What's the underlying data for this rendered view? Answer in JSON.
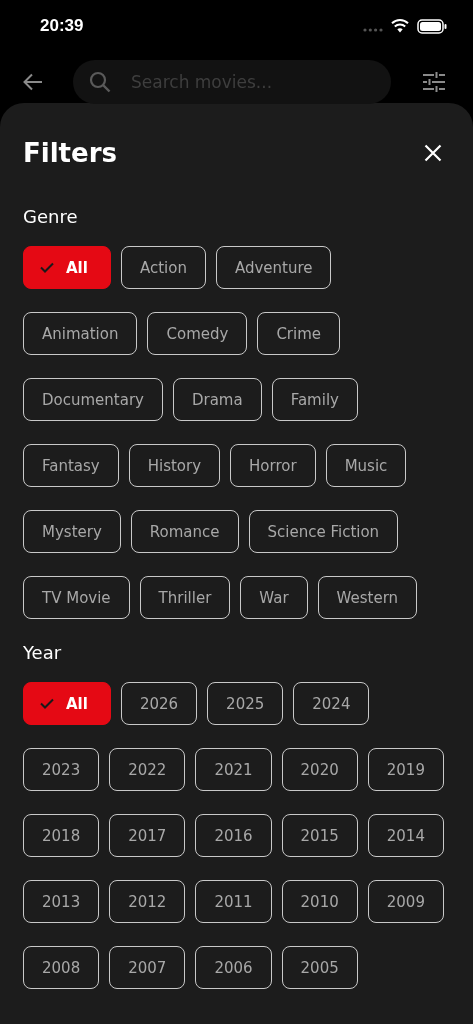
{
  "status_bar": {
    "time": "20:39"
  },
  "search": {
    "placeholder": "Search movies..."
  },
  "sheet": {
    "title": "Filters"
  },
  "sections": [
    {
      "label": "Genre",
      "rows": [
        [
          {
            "label": "All",
            "selected": true
          },
          {
            "label": "Action",
            "selected": false
          },
          {
            "label": "Adventure",
            "selected": false
          }
        ],
        [
          {
            "label": "Animation",
            "selected": false
          },
          {
            "label": "Comedy",
            "selected": false
          },
          {
            "label": "Crime",
            "selected": false
          }
        ],
        [
          {
            "label": "Documentary",
            "selected": false
          },
          {
            "label": "Drama",
            "selected": false
          },
          {
            "label": "Family",
            "selected": false
          }
        ],
        [
          {
            "label": "Fantasy",
            "selected": false
          },
          {
            "label": "History",
            "selected": false
          },
          {
            "label": "Horror",
            "selected": false
          },
          {
            "label": "Music",
            "selected": false
          }
        ],
        [
          {
            "label": "Mystery",
            "selected": false
          },
          {
            "label": "Romance",
            "selected": false
          },
          {
            "label": "Science Fiction",
            "selected": false
          }
        ],
        [
          {
            "label": "TV Movie",
            "selected": false
          },
          {
            "label": "Thriller",
            "selected": false
          },
          {
            "label": "War",
            "selected": false
          },
          {
            "label": "Western",
            "selected": false
          }
        ]
      ]
    },
    {
      "label": "Year",
      "rows": [
        [
          {
            "label": "All",
            "selected": true
          },
          {
            "label": "2026",
            "selected": false
          },
          {
            "label": "2025",
            "selected": false
          },
          {
            "label": "2024",
            "selected": false
          }
        ],
        [
          {
            "label": "2023",
            "selected": false
          },
          {
            "label": "2022",
            "selected": false
          },
          {
            "label": "2021",
            "selected": false
          },
          {
            "label": "2020",
            "selected": false
          },
          {
            "label": "2019",
            "selected": false
          }
        ],
        [
          {
            "label": "2018",
            "selected": false
          },
          {
            "label": "2017",
            "selected": false
          },
          {
            "label": "2016",
            "selected": false
          },
          {
            "label": "2015",
            "selected": false
          },
          {
            "label": "2014",
            "selected": false
          }
        ],
        [
          {
            "label": "2013",
            "selected": false
          },
          {
            "label": "2012",
            "selected": false
          },
          {
            "label": "2011",
            "selected": false
          },
          {
            "label": "2010",
            "selected": false
          },
          {
            "label": "2009",
            "selected": false
          }
        ],
        [
          {
            "label": "2008",
            "selected": false
          },
          {
            "label": "2007",
            "selected": false
          },
          {
            "label": "2006",
            "selected": false
          },
          {
            "label": "2005",
            "selected": false
          }
        ]
      ]
    }
  ]
}
